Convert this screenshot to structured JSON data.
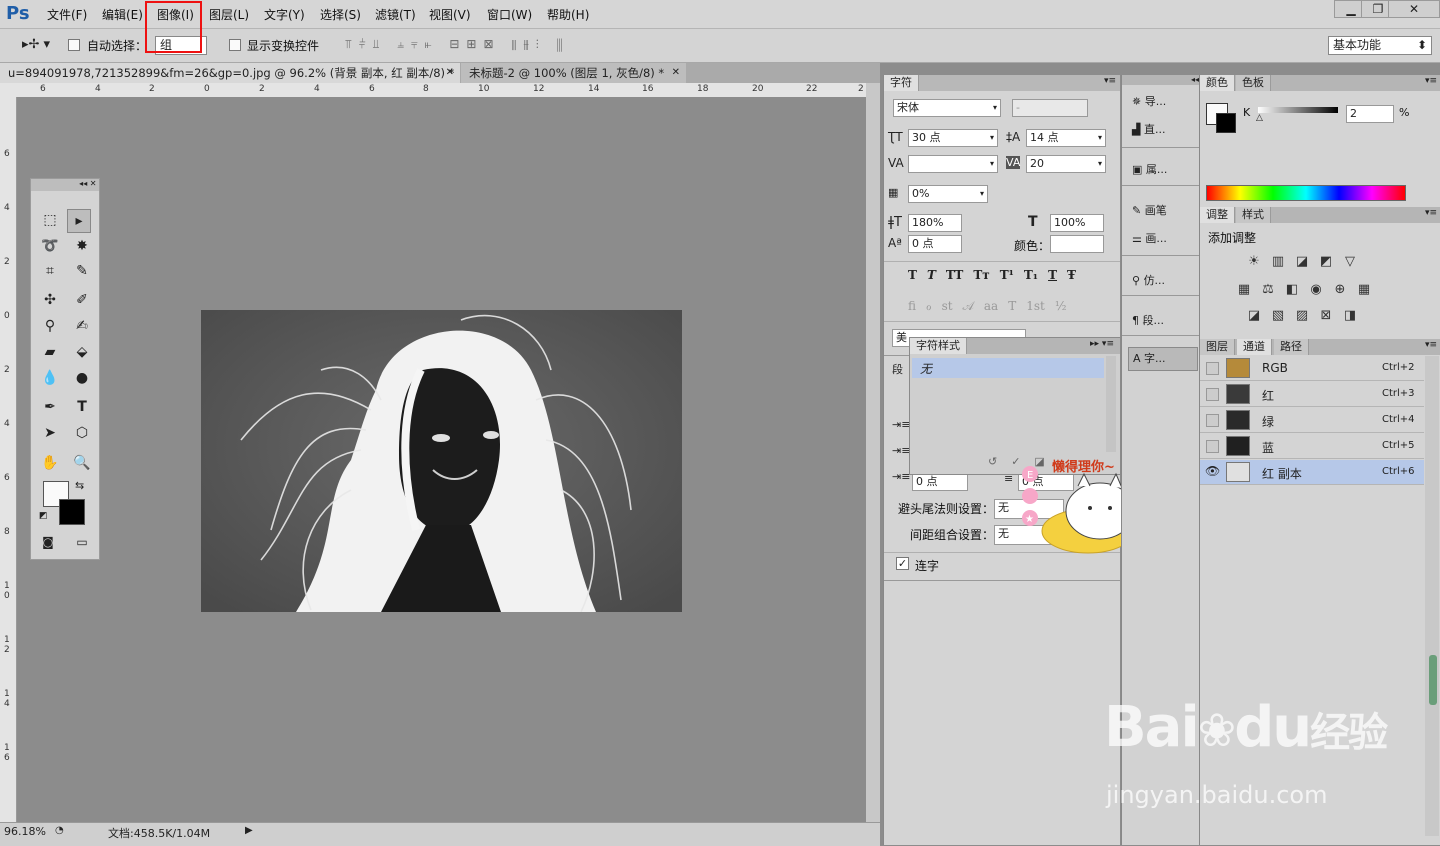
{
  "app": {
    "logo": "Ps"
  },
  "menu": [
    "文件(F)",
    "编辑(E)",
    "图像(I)",
    "图层(L)",
    "文字(Y)",
    "选择(S)",
    "滤镜(T)",
    "视图(V)",
    "窗口(W)",
    "帮助(H)"
  ],
  "window_controls": [
    "▁",
    "❐",
    "✕"
  ],
  "options": {
    "auto_select_label": "自动选择：",
    "auto_select_value": "组",
    "show_transform_label": "显示变换控件",
    "workspace": "基本功能"
  },
  "tabs": [
    {
      "label": "u=894091978,721352899&fm=26&gp=0.jpg @ 96.2% (背景 副本, 红 副本/8) *",
      "close": "✕"
    },
    {
      "label": "未标题-2 @ 100% (图层 1, 灰色/8) *",
      "close": "✕"
    }
  ],
  "ruler_h": [
    "6",
    "4",
    "2",
    "0",
    "2",
    "4",
    "6",
    "8",
    "10",
    "12",
    "14",
    "16",
    "18",
    "20",
    "22",
    "2"
  ],
  "ruler_v": [
    "6",
    "4",
    "2",
    "0",
    "2",
    "4",
    "6",
    "8",
    "1 0",
    "1 2",
    "1 4",
    "1 6"
  ],
  "status": {
    "zoom": "96.18%",
    "doc": "文档:458.5K/1.04M"
  },
  "character": {
    "tab": "字符",
    "font": "宋体",
    "style": "-",
    "size": "30 点",
    "leading": "14 点",
    "kerning": "",
    "tracking": "20",
    "tsume": "0%",
    "vscale": "180%",
    "hscale": "100%",
    "baseline": "0 点",
    "color_label": "颜色：",
    "lang_prefix": "美",
    "type_buttons": [
      "T",
      "T",
      "TT",
      "Tт",
      "T¹",
      "T₁",
      "T",
      "Ŧ"
    ],
    "ot_buttons": [
      "ﬁ",
      "ℴ",
      "st",
      "𝒜",
      "aa",
      "T",
      "1st",
      "½"
    ]
  },
  "char_style": {
    "tab": "字符样式",
    "item": "无"
  },
  "paragraph": {
    "tab_prefix": "段",
    "indent_value": "0 点",
    "indent_value2": "0 点",
    "kinsoku_label": "避头尾法则设置：",
    "kinsoku_value": "无",
    "mojikumi_label": "间距组合设置：",
    "mojikumi_value": "无",
    "hyphenate_label": "连字"
  },
  "sticker": {
    "text": "懒得理你~"
  },
  "dock": [
    "导...",
    "直...",
    "属...",
    "画笔",
    "画...",
    "仿...",
    "段...",
    "字..."
  ],
  "color_panel": {
    "tabs": [
      "颜色",
      "色板"
    ],
    "channel": "K",
    "value": "2",
    "unit": "%"
  },
  "adjust_panel": {
    "tabs": [
      "调整",
      "样式"
    ],
    "title": "添加调整"
  },
  "layers_panel": {
    "tabs": [
      "图层",
      "通道",
      "路径"
    ],
    "channels": [
      {
        "name": "RGB",
        "shortcut": "Ctrl+2"
      },
      {
        "name": "红",
        "shortcut": "Ctrl+3"
      },
      {
        "name": "绿",
        "shortcut": "Ctrl+4"
      },
      {
        "name": "蓝",
        "shortcut": "Ctrl+5"
      },
      {
        "name": "红 副本",
        "shortcut": "Ctrl+6"
      }
    ]
  },
  "watermark": {
    "brand": "Bai",
    "brand2": "du",
    "cn": "经验",
    "url": "jingyan.baidu.com"
  }
}
